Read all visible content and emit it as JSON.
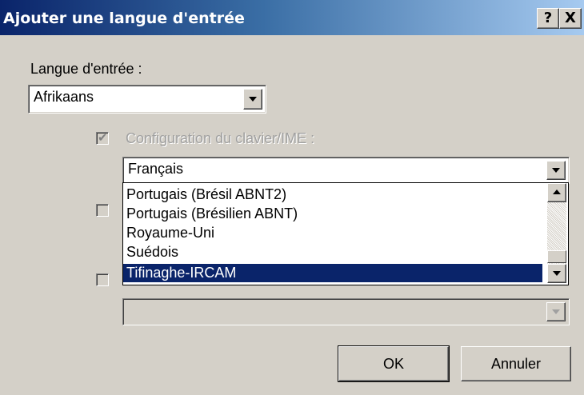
{
  "window": {
    "title": "Ajouter une langue d'entrée",
    "help_label": "?",
    "close_label": "X"
  },
  "input_language": {
    "label": "Langue d'entrée :",
    "selected": "Afrikaans"
  },
  "keyboard_layout": {
    "label": "Configuration du clavier/IME :",
    "checked": true,
    "enabled": false,
    "selected": "Français",
    "options": [
      "Portugais (Brésil ABNT2)",
      "Portugais (Brésilien ABNT)",
      "Royaume-Uni",
      "Suédois",
      "Tifinaghe-IRCAM"
    ],
    "highlighted": "Tifinaghe-IRCAM"
  },
  "second_option": {
    "checked": false,
    "enabled": false
  },
  "third_option": {
    "checked": false,
    "enabled": false,
    "selected": ""
  },
  "buttons": {
    "ok": "OK",
    "cancel": "Annuler"
  }
}
